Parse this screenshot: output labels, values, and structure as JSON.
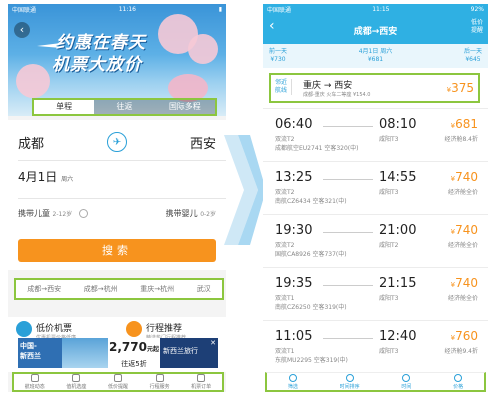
{
  "left": {
    "status": {
      "carrier": "中国联通",
      "time": "11:16"
    },
    "banner": {
      "title_line1": "约惠在春天",
      "title_line2": "机票大放价"
    },
    "tabs": [
      "单程",
      "往返",
      "国际多程"
    ],
    "from_city": "成都",
    "to_city": "西安",
    "date": "4月1日",
    "weekday": "周六",
    "pax_child_label": "携带儿童",
    "pax_child_age": "2-12岁",
    "pax_infant_label": "携带婴儿",
    "pax_infant_age": "0-2岁",
    "search_label": "搜索",
    "history": [
      "成都→西安",
      "成都→杭州",
      "重庆→杭州",
      "武汉"
    ],
    "promo": [
      {
        "title": "低价机票",
        "sub": "优惠机票价格低廉"
      },
      {
        "title": "行程推荐",
        "sub": "精选热门行程推荐"
      }
    ],
    "ad": {
      "line1": "中国-",
      "line2": "新西兰",
      "price": "2,770",
      "price_unit": "元起",
      "days": "往返5折",
      "right": "新西兰旅行"
    },
    "nav": [
      "航班动态",
      "值机选座",
      "低价提醒",
      "行程服务",
      "机票订单"
    ]
  },
  "right": {
    "status": {
      "carrier": "中国联通",
      "time": "11:15",
      "battery": "92%"
    },
    "route": "成都→西安",
    "low_remind": [
      "低价",
      "提醒"
    ],
    "prev_day": {
      "label": "前一天",
      "price": "¥730"
    },
    "cur_day": {
      "label": "4月1日 周六",
      "price": "¥681"
    },
    "next_day": {
      "label": "后一天",
      "price": "¥645"
    },
    "nearby": {
      "tag1": "邻近",
      "tag2": "航线",
      "route": "重庆 → 西安",
      "sub": "成都-重庆 火车二等座 ¥154.0",
      "price": "375"
    },
    "flights": [
      {
        "dep": "06:40",
        "arr": "08:10",
        "dapt": "双流T2",
        "aapt": "咸阳T3",
        "no": "成都航空EU2741 空客320(中)",
        "price": "681",
        "cabin": "经济舱8.4折"
      },
      {
        "dep": "13:25",
        "arr": "14:55",
        "dapt": "双流T2",
        "aapt": "咸阳T3",
        "no": "南航CZ6434 空客321(中)",
        "price": "740",
        "cabin": "经济舱全价"
      },
      {
        "dep": "19:30",
        "arr": "21:00",
        "dapt": "双流T2",
        "aapt": "咸阳T2",
        "no": "国航CA8926 空客737(中)",
        "price": "740",
        "cabin": "经济舱全价"
      },
      {
        "dep": "19:35",
        "arr": "21:15",
        "dapt": "双流T1",
        "aapt": "咸阳T3",
        "no": "南航CZ6250 空客319(中)",
        "price": "740",
        "cabin": "经济舱全价"
      },
      {
        "dep": "11:05",
        "arr": "12:40",
        "dapt": "双流T1",
        "aapt": "咸阳T3",
        "no": "东航MU2295 空客319(中)",
        "price": "760",
        "cabin": "经济舱9.4折"
      }
    ],
    "nav": [
      "筛选",
      "时间排序",
      "时间",
      "价格"
    ],
    "currency": "¥"
  }
}
